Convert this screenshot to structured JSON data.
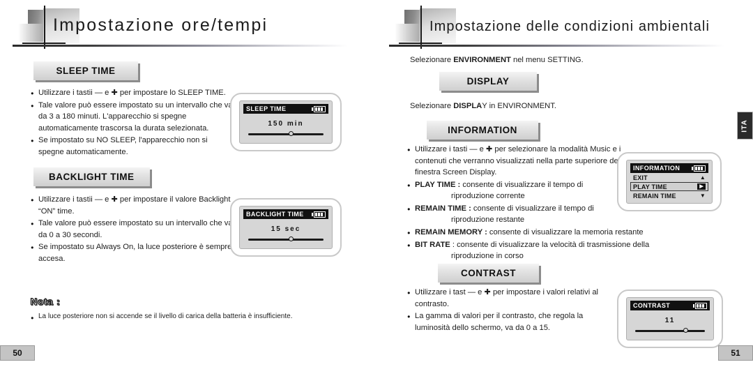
{
  "left_page": {
    "header_title": "Impostazione ore/tempi",
    "page_number": "50",
    "sleep": {
      "pill": "SLEEP TIME",
      "b1": "Utilizzare i tastii — e ✚ per impostare lo SLEEP TIME.",
      "b2": "Tale valore può essere impostato su un intervallo che va da 3 a 180 minuti. L'apparecchio si spegne automaticamente trascorsa la durata selezionata.",
      "b3": "Se impostato su NO SLEEP, l'apparecchio non si spegne automaticamente.",
      "lcd_title": "SLEEP TIME",
      "lcd_value": "150  min",
      "slider_percent": 57
    },
    "backlight": {
      "pill": "BACKLIGHT TIME",
      "b1": "Utilizzare i tastii — e ✚ per impostare il valore Backlight “ON” time.",
      "b2": "Tale valore può essere impostato su un intervallo che va da 0 a 30 secondi.",
      "b3": "Se impostato su Always On, la luce posteriore è sempre accesa.",
      "lcd_title": "BACKLIGHT TIME",
      "lcd_value": "15  sec",
      "slider_percent": 57
    },
    "nota": {
      "title": "Nota :",
      "body": "La luce posteriore non si accende se il livello di carica della batteria è insufficiente."
    }
  },
  "right_page": {
    "header_title": "Impostazione delle condizioni ambientali",
    "page_number": "51",
    "side_tab": "ITA",
    "intro_pre": "Selezionare ",
    "intro_bold": "ENVIRONMENT",
    "intro_post": " nel menu SETTING.",
    "display": {
      "pill": "DISPLAY",
      "line_pre": "Selezionare ",
      "line_bold": "DISPLA",
      "line_post": "Y in ENVIRONMENT."
    },
    "information": {
      "pill": "INFORMATION",
      "b1": "Utilizzare i tasti — e ✚ per selezionare la modalità Music e i contenuti che verranno visualizzati nella parte superiore della finestra Screen Display.",
      "b2_bold": "PLAY TIME :",
      "b2_text": " consente di visualizzare il tempo di",
      "b2_cont": "riproduzione corrente",
      "b3_bold": "REMAIN TIME :",
      "b3_text": " consente di visualizzare il tempo di",
      "b3_cont": "riproduzione restante",
      "b4_bold": "REMAIN MEMORY :",
      "b4_text": " consente di visualizzare la memoria restante",
      "b5_bold": "BIT RATE",
      "b5_text": " : consente di visualizzare la velocità di trasmissione della",
      "b5_cont": "riproduzione in corso",
      "lcd_title": "INFORMATION",
      "menu": [
        {
          "label": "EXIT",
          "arrow": "▲",
          "selected": false
        },
        {
          "label": "PLAY TIME",
          "arrow": "▶",
          "selected": true
        },
        {
          "label": "REMAIN TIME",
          "arrow": "▼",
          "selected": false
        }
      ]
    },
    "contrast": {
      "pill": "CONTRAST",
      "b1": "Utilizzare i tast — e ✚ per impostare i valori relativi al contrasto.",
      "b2": "La gamma di valori per il contrasto, che regola la luminosità dello schermo, va da 0 a 15.",
      "lcd_title": "CONTRAST",
      "lcd_value": "11",
      "slider_percent": 72
    }
  }
}
